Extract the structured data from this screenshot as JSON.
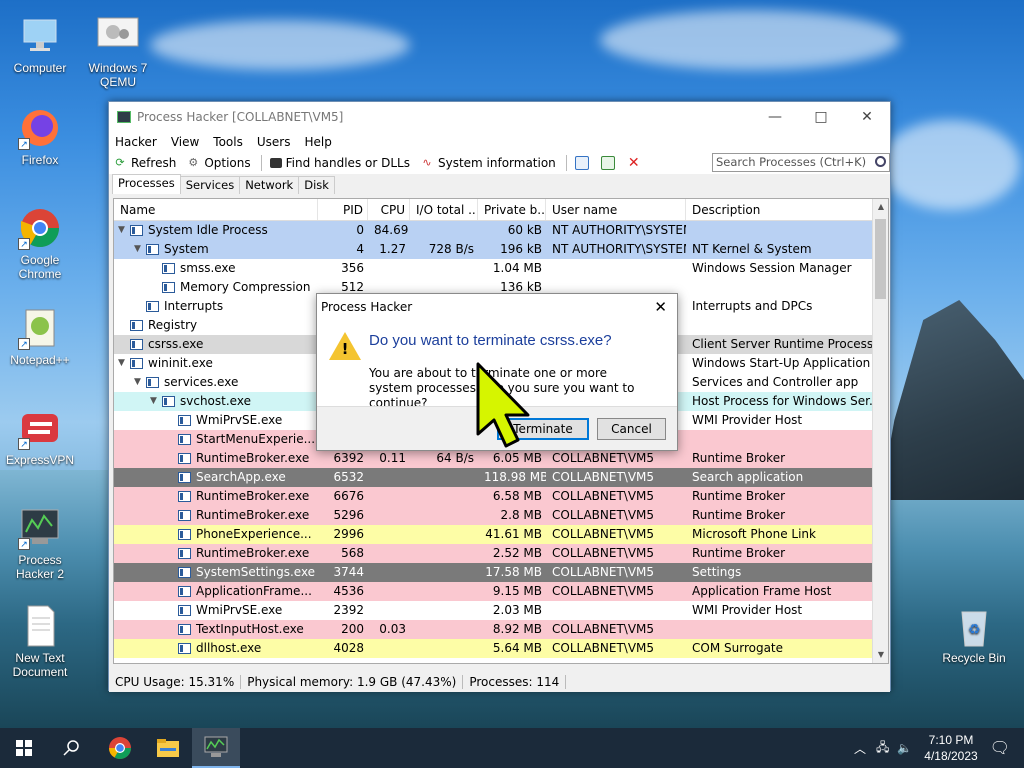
{
  "desktop": {
    "icons": [
      {
        "label": "Computer"
      },
      {
        "label": "Windows 7 QEMU"
      },
      {
        "label": "Firefox"
      },
      {
        "label": "Google Chrome"
      },
      {
        "label": "Notepad++"
      },
      {
        "label": "ExpressVPN"
      },
      {
        "label": "Process Hacker 2"
      },
      {
        "label": "New Text Document"
      },
      {
        "label": "Recycle Bin"
      }
    ]
  },
  "window": {
    "title": "Process Hacker [COLLABNET\\VM5]",
    "menu": [
      "Hacker",
      "View",
      "Tools",
      "Users",
      "Help"
    ],
    "toolbar": {
      "refresh": "Refresh",
      "options": "Options",
      "find": "Find handles or DLLs",
      "sysinfo": "System information",
      "search_placeholder": "Search Processes (Ctrl+K)"
    },
    "tabs": [
      "Processes",
      "Services",
      "Network",
      "Disk"
    ],
    "columns": [
      "Name",
      "PID",
      "CPU",
      "I/O total ...",
      "Private b...",
      "User name",
      "Description"
    ],
    "rows": [
      {
        "name": "System Idle Process",
        "pid": "0",
        "cpu": "84.69",
        "io": "",
        "priv": "60 kB",
        "user": "NT AUTHORITY\\SYSTEM",
        "desc": "",
        "indent": 0,
        "tw": "v",
        "bg": "#b9d1f3"
      },
      {
        "name": "System",
        "pid": "4",
        "cpu": "1.27",
        "io": "728 B/s",
        "priv": "196 kB",
        "user": "NT AUTHORITY\\SYSTEM",
        "desc": "NT Kernel & System",
        "indent": 1,
        "tw": "v",
        "bg": "#b9d1f3"
      },
      {
        "name": "smss.exe",
        "pid": "356",
        "cpu": "",
        "io": "",
        "priv": "1.04 MB",
        "user": "",
        "desc": "Windows Session Manager",
        "indent": 2,
        "tw": "",
        "bg": "#ffffff"
      },
      {
        "name": "Memory Compression",
        "pid": "512",
        "cpu": "",
        "io": "",
        "priv": "136 kB",
        "user": "",
        "desc": "",
        "indent": 2,
        "tw": "",
        "bg": "#ffffff"
      },
      {
        "name": "Interrupts",
        "pid": "",
        "cpu": "",
        "io": "",
        "priv": "",
        "user": "",
        "desc": "Interrupts and DPCs",
        "indent": 1,
        "tw": "",
        "bg": "#ffffff"
      },
      {
        "name": "Registry",
        "pid": "",
        "cpu": "",
        "io": "",
        "priv": "",
        "user": "",
        "desc": "",
        "indent": 0,
        "tw": "",
        "bg": "#ffffff"
      },
      {
        "name": "csrss.exe",
        "pid": "",
        "cpu": "",
        "io": "",
        "priv": "",
        "user": "",
        "desc": "Client Server Runtime Process",
        "indent": 0,
        "tw": "",
        "bg": "#d8d8d8"
      },
      {
        "name": "wininit.exe",
        "pid": "",
        "cpu": "",
        "io": "",
        "priv": "",
        "user": "",
        "desc": "Windows Start-Up Application",
        "indent": 0,
        "tw": "v",
        "bg": "#ffffff"
      },
      {
        "name": "services.exe",
        "pid": "",
        "cpu": "",
        "io": "",
        "priv": "",
        "user": "",
        "desc": "Services and Controller app",
        "indent": 1,
        "tw": "v",
        "bg": "#ffffff"
      },
      {
        "name": "svchost.exe",
        "pid": "",
        "cpu": "",
        "io": "",
        "priv": "",
        "user": "",
        "desc": "Host Process for Windows Ser...",
        "indent": 2,
        "tw": "v",
        "bg": "#d0f5f5"
      },
      {
        "name": "WmiPrvSE.exe",
        "pid": "",
        "cpu": "",
        "io": "",
        "priv": "",
        "user": "",
        "desc": "WMI Provider Host",
        "indent": 3,
        "tw": "",
        "bg": "#ffffff"
      },
      {
        "name": "StartMenuExperie...",
        "pid": "",
        "cpu": "",
        "io": "",
        "priv": "",
        "user": "",
        "desc": "",
        "indent": 3,
        "tw": "",
        "bg": "#fac8d0"
      },
      {
        "name": "RuntimeBroker.exe",
        "pid": "6392",
        "cpu": "0.11",
        "io": "64 B/s",
        "priv": "6.05 MB",
        "user": "COLLABNET\\VM5",
        "desc": "Runtime Broker",
        "indent": 3,
        "tw": "",
        "bg": "#fac8d0"
      },
      {
        "name": "SearchApp.exe",
        "pid": "6532",
        "cpu": "",
        "io": "",
        "priv": "118.98 MB",
        "user": "COLLABNET\\VM5",
        "desc": "Search application",
        "indent": 3,
        "tw": "",
        "bg": "#7a7a7a"
      },
      {
        "name": "RuntimeBroker.exe",
        "pid": "6676",
        "cpu": "",
        "io": "",
        "priv": "6.58 MB",
        "user": "COLLABNET\\VM5",
        "desc": "Runtime Broker",
        "indent": 3,
        "tw": "",
        "bg": "#fac8d0"
      },
      {
        "name": "RuntimeBroker.exe",
        "pid": "5296",
        "cpu": "",
        "io": "",
        "priv": "2.8 MB",
        "user": "COLLABNET\\VM5",
        "desc": "Runtime Broker",
        "indent": 3,
        "tw": "",
        "bg": "#fac8d0"
      },
      {
        "name": "PhoneExperience...",
        "pid": "2996",
        "cpu": "",
        "io": "",
        "priv": "41.61 MB",
        "user": "COLLABNET\\VM5",
        "desc": "Microsoft Phone Link",
        "indent": 3,
        "tw": "",
        "bg": "#fdfda6"
      },
      {
        "name": "RuntimeBroker.exe",
        "pid": "568",
        "cpu": "",
        "io": "",
        "priv": "2.52 MB",
        "user": "COLLABNET\\VM5",
        "desc": "Runtime Broker",
        "indent": 3,
        "tw": "",
        "bg": "#fac8d0"
      },
      {
        "name": "SystemSettings.exe",
        "pid": "3744",
        "cpu": "",
        "io": "",
        "priv": "17.58 MB",
        "user": "COLLABNET\\VM5",
        "desc": "Settings",
        "indent": 3,
        "tw": "",
        "bg": "#7a7a7a"
      },
      {
        "name": "ApplicationFrame...",
        "pid": "4536",
        "cpu": "",
        "io": "",
        "priv": "9.15 MB",
        "user": "COLLABNET\\VM5",
        "desc": "Application Frame Host",
        "indent": 3,
        "tw": "",
        "bg": "#fac8d0"
      },
      {
        "name": "WmiPrvSE.exe",
        "pid": "2392",
        "cpu": "",
        "io": "",
        "priv": "2.03 MB",
        "user": "",
        "desc": "WMI Provider Host",
        "indent": 3,
        "tw": "",
        "bg": "#ffffff"
      },
      {
        "name": "TextInputHost.exe",
        "pid": "200",
        "cpu": "0.03",
        "io": "",
        "priv": "8.92 MB",
        "user": "COLLABNET\\VM5",
        "desc": "",
        "indent": 3,
        "tw": "",
        "bg": "#fac8d0"
      },
      {
        "name": "dllhost.exe",
        "pid": "4028",
        "cpu": "",
        "io": "",
        "priv": "5.64 MB",
        "user": "COLLABNET\\VM5",
        "desc": "COM Surrogate",
        "indent": 3,
        "tw": "",
        "bg": "#fdfda6"
      }
    ],
    "status": {
      "cpu": "CPU Usage: 15.31%",
      "mem": "Physical memory: 1.9 GB (47.43%)",
      "procs": "Processes: 114"
    }
  },
  "dialog": {
    "title": "Process Hacker",
    "question": "Do you want to terminate csrss.exe?",
    "message": "You are about to terminate one or more system processes. Are you sure you want to continue?",
    "terminate": "Terminate",
    "cancel": "Cancel"
  },
  "taskbar": {
    "time": "7:10 PM",
    "date": "4/18/2023"
  },
  "colors": {
    "accent": "#0078d7",
    "taskbar": "#1b2a3a",
    "question": "#1c3f9c"
  }
}
